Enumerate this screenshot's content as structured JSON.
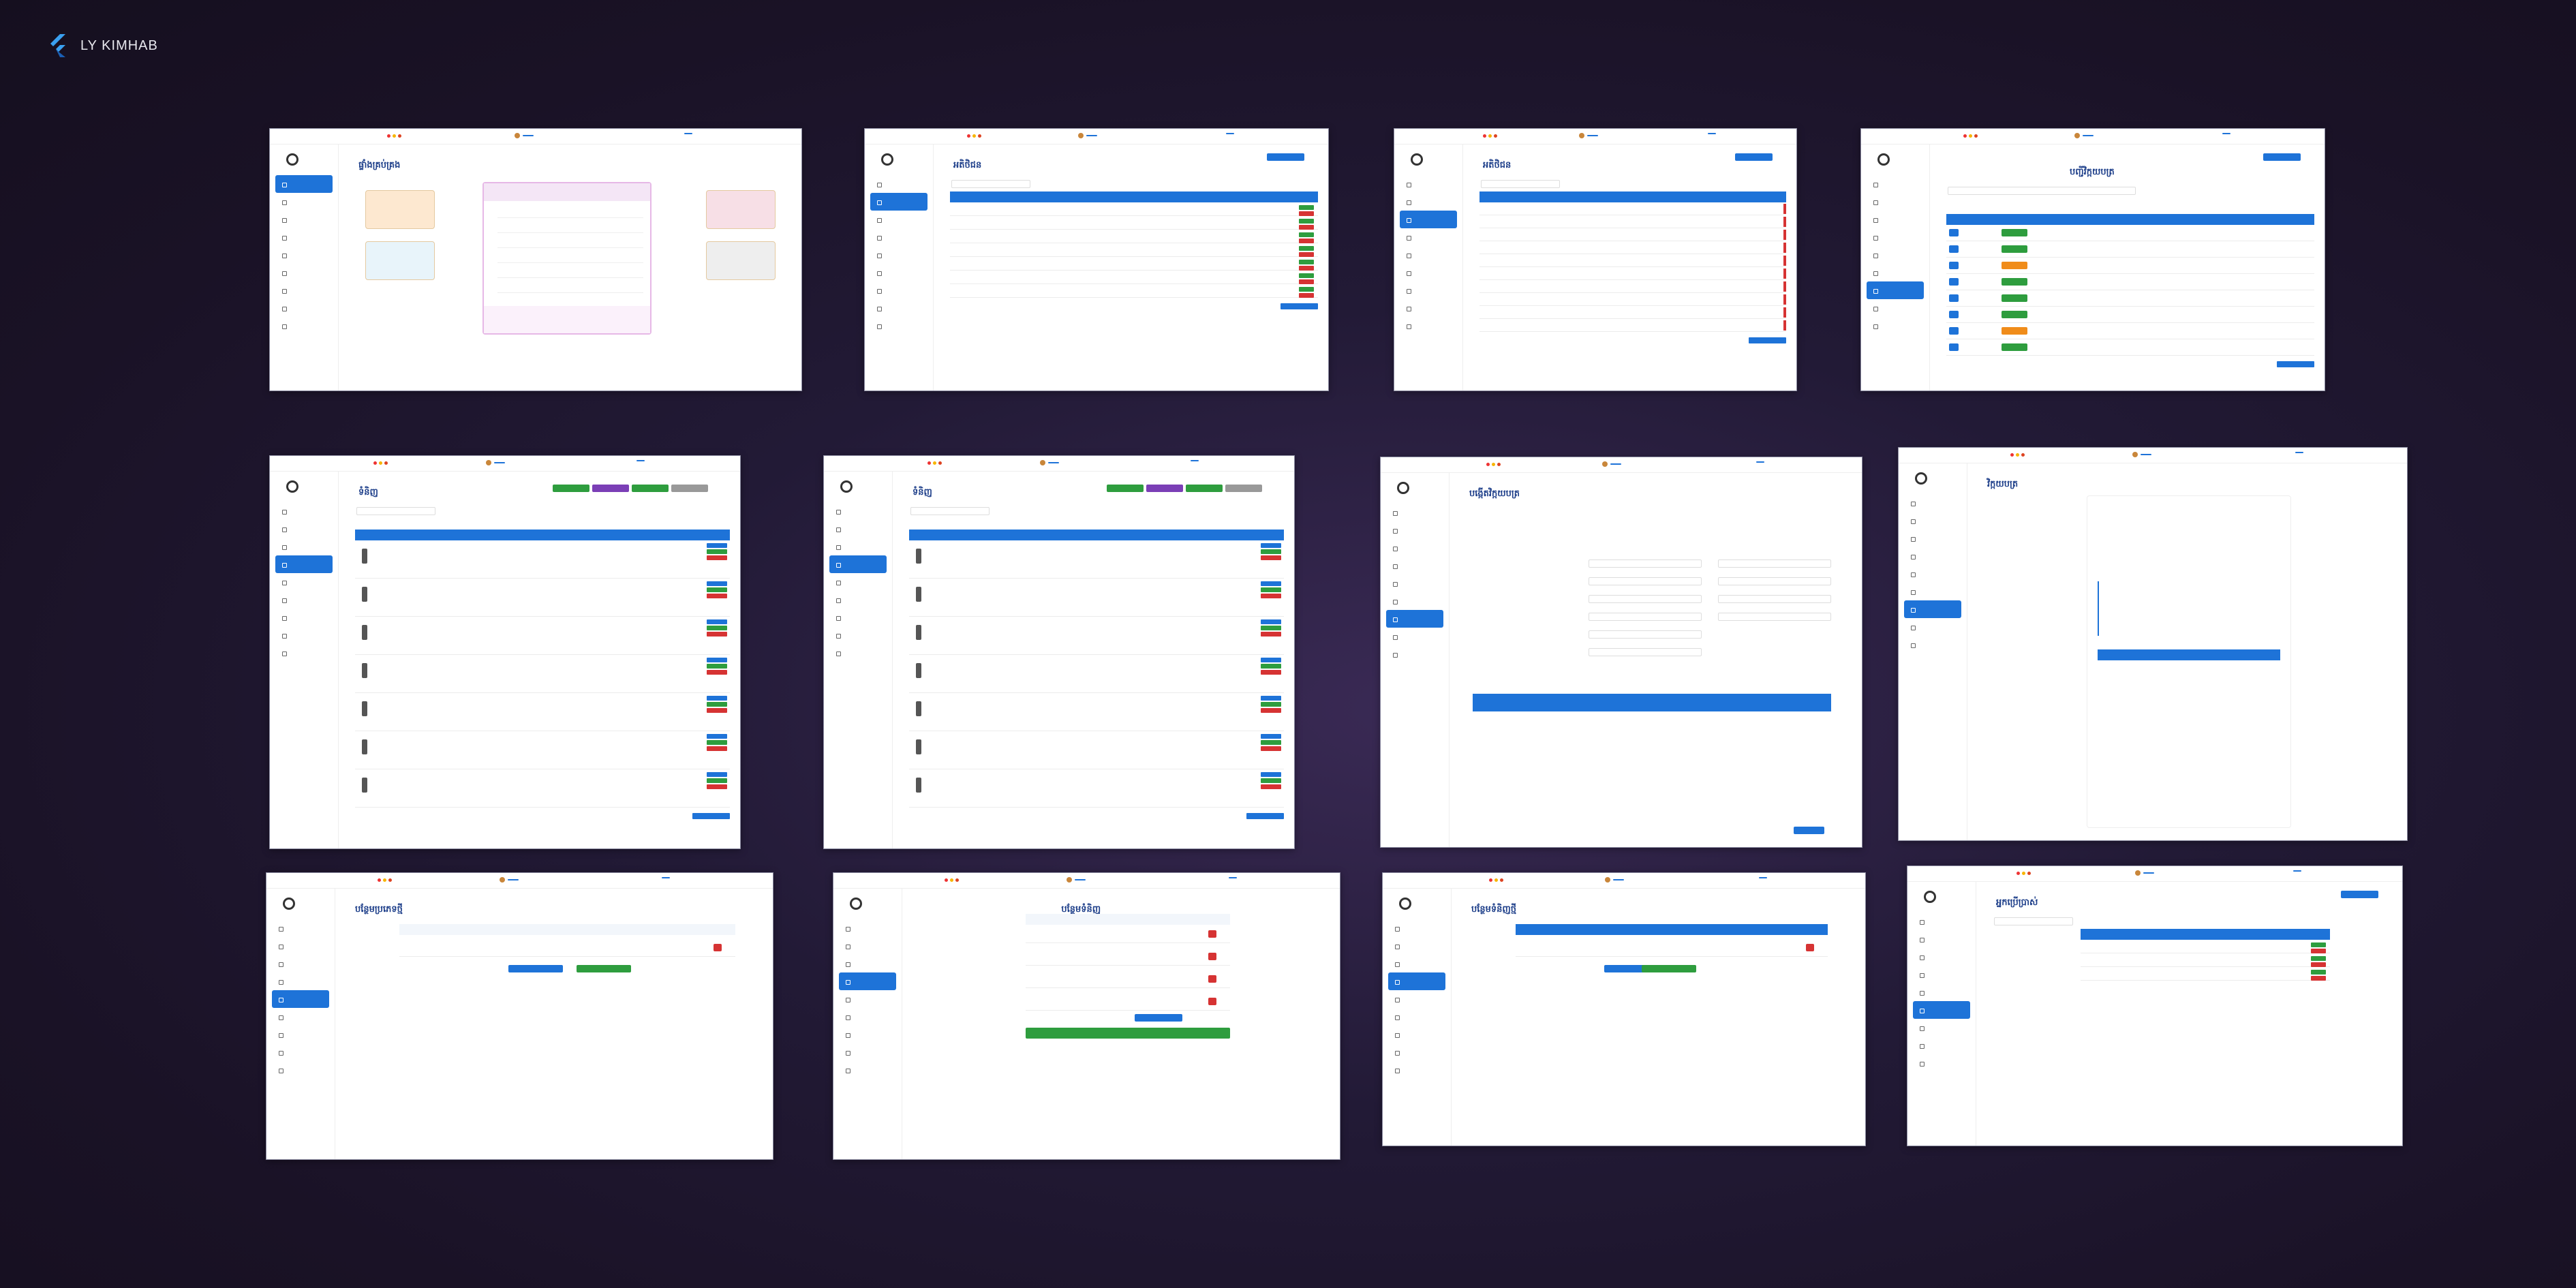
{
  "brand": {
    "name": "LY KIMHAB",
    "logo_icon": "flutter-logo-icon",
    "colors": {
      "background": "#1a1226",
      "accent": "#1e73d8",
      "success": "#2e9d3e",
      "danger": "#d63333",
      "purple": "#7b3fb6"
    }
  },
  "screens": [
    {
      "name": "dashboard",
      "title": "ផ្ទាំងគ្រប់គ្រង"
    },
    {
      "name": "customers",
      "title": "អតិថិជន"
    },
    {
      "name": "list-table",
      "title": "អតិថិជន"
    },
    {
      "name": "invoice-list",
      "title": "បញ្ជីវិក្កយបត្រ"
    },
    {
      "name": "products-a",
      "title": "ទំនិញ"
    },
    {
      "name": "products-b",
      "title": "ទំនិញ"
    },
    {
      "name": "create-invoice",
      "title": "បង្កើតវិក្កយបត្រ"
    },
    {
      "name": "invoice-preview",
      "title": "វិក្កយបត្រ"
    },
    {
      "name": "add-category",
      "title": "បន្ថែមប្រភេទថ្មី"
    },
    {
      "name": "add-products",
      "title": "បន្ថែមទំនិញ"
    },
    {
      "name": "add-new-product",
      "title": "បន្ថែមទំនិញថ្មី"
    },
    {
      "name": "user-list",
      "title": "អ្នកប្រើប្រាស់"
    }
  ]
}
